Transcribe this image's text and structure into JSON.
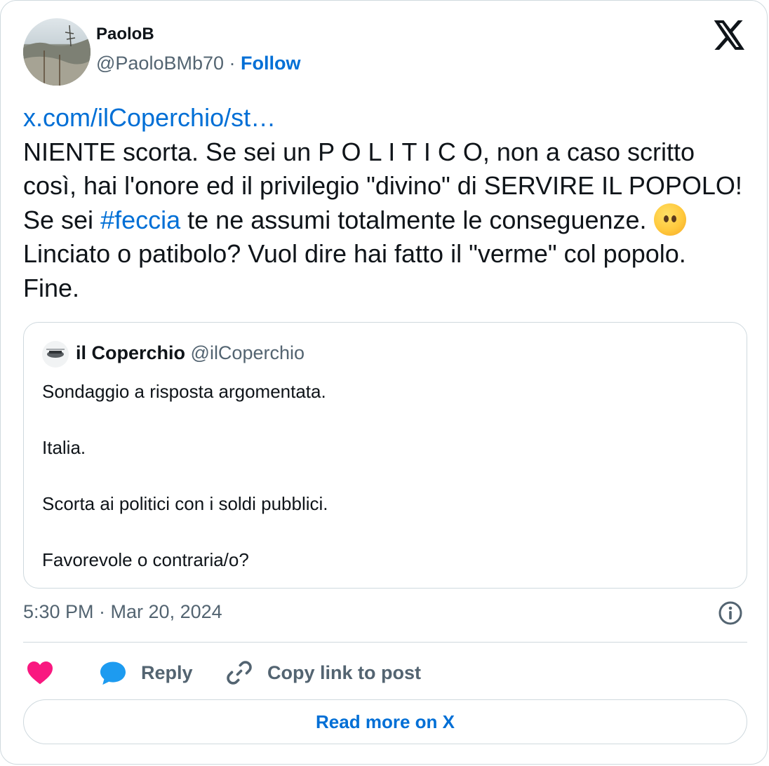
{
  "author": {
    "name": "PaoloB",
    "handle": "@PaoloBMb70",
    "separator": "·",
    "follow_label": "Follow"
  },
  "tweet": {
    "link": "x.com/ilCoperchio/st…",
    "text_part1": "NIENTE scorta. Se sei un P O L I T I C O, non a caso scritto così,  hai l'onore ed il privilegio \"divino\" di SERVIRE IL POPOLO! Se sei ",
    "hashtag": "#feccia",
    "text_part2": " te ne assumi totalmente le conseguenze. ",
    "emoji": "face-without-mouth",
    "text_part3": " Linciato o patibolo? Vuol dire hai fatto il \"verme\" col popolo. Fine."
  },
  "quoted": {
    "name": "il Coperchio",
    "handle": "@ilCoperchio",
    "lines": [
      "Sondaggio a risposta argomentata.",
      "",
      "Italia.",
      "",
      "Scorta ai politici con i soldi pubblici.",
      "",
      "Favorevole o contraria/o?"
    ]
  },
  "timestamp": "5:30 PM · Mar 20, 2024",
  "actions": {
    "like_icon": "heart-icon",
    "reply_label": "Reply",
    "copy_label": "Copy link to post"
  },
  "read_more_label": "Read more on X",
  "colors": {
    "link": "#006fd6",
    "secondary_text": "#536471",
    "border": "#cfd9de",
    "like": "#f91880",
    "reply": "#1d9bf0"
  }
}
